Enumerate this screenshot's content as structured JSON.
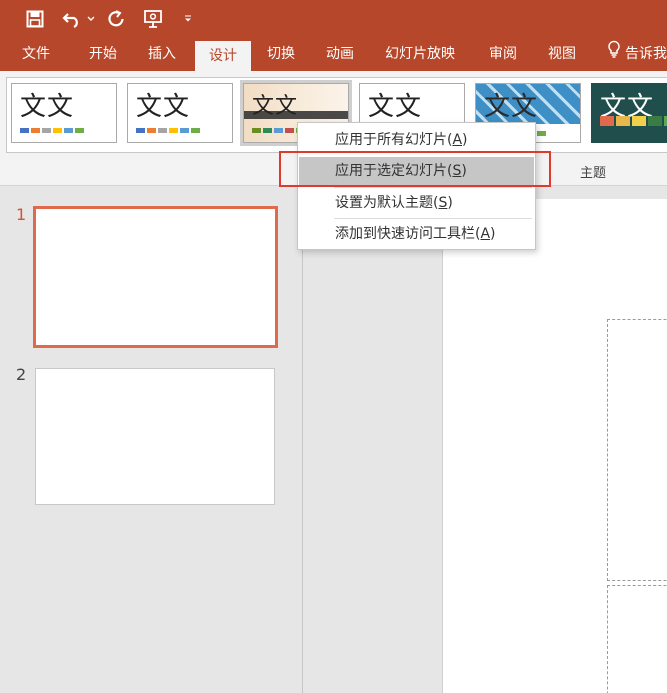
{
  "app": {
    "colors": {
      "accent": "#b7472a",
      "tab_active_bg": "#f3f3f3",
      "highlight": "#e03a2f",
      "slide_selected": "#e06a4b"
    },
    "quick_access": [
      {
        "icon": "save-icon"
      },
      {
        "icon": "undo-icon"
      },
      {
        "icon": "undo-dropdown-icon"
      },
      {
        "icon": "redo-icon"
      },
      {
        "icon": "presenter-icon"
      },
      {
        "icon": "customize-dropdown-icon"
      }
    ]
  },
  "tabs": [
    {
      "label": "文件"
    },
    {
      "label": "开始"
    },
    {
      "label": "插入"
    },
    {
      "label": "设计"
    },
    {
      "label": "切换"
    },
    {
      "label": "动画"
    },
    {
      "label": "幻灯片放映"
    },
    {
      "label": "审阅"
    },
    {
      "label": "视图"
    }
  ],
  "tell_me": {
    "label": "告诉我",
    "icon": "lightbulb-icon"
  },
  "themes": {
    "group_label": "主题",
    "items": [
      {
        "text": "文文",
        "bars": [
          "#4472c4",
          "#ed7d31",
          "#a5a5a5",
          "#ffc000",
          "#5b9bd5",
          "#70ad47"
        ]
      },
      {
        "text": "文文",
        "bars": [
          "#4472c4",
          "#ed7d31",
          "#a5a5a5",
          "#ffc000",
          "#5b9bd5",
          "#70ad47"
        ]
      },
      {
        "text": "文文",
        "bars": [
          "#6b8e23",
          "#2e8b57",
          "#5b9bd5",
          "#c0504d",
          "#70ad47",
          "#8064a2"
        ]
      },
      {
        "text": "文文",
        "bars": []
      },
      {
        "text": "文文",
        "bars": [
          "#4bacc6",
          "#70ad47"
        ]
      },
      {
        "text": "文文",
        "bars": [
          "#e06a4b",
          "#e8b74b",
          "#f0d04b",
          "#3a7d44",
          "#5fa55a"
        ]
      }
    ]
  },
  "context_menu": {
    "items": [
      {
        "label": "应用于所有幻灯片",
        "key": "A"
      },
      {
        "label": "应用于选定幻灯片",
        "key": "S"
      },
      {
        "label": "设置为默认主题",
        "key": "S"
      },
      {
        "label": "添加到快速访问工具栏",
        "key": "A"
      }
    ]
  },
  "slides": [
    {
      "number": "1"
    },
    {
      "number": "2"
    }
  ]
}
